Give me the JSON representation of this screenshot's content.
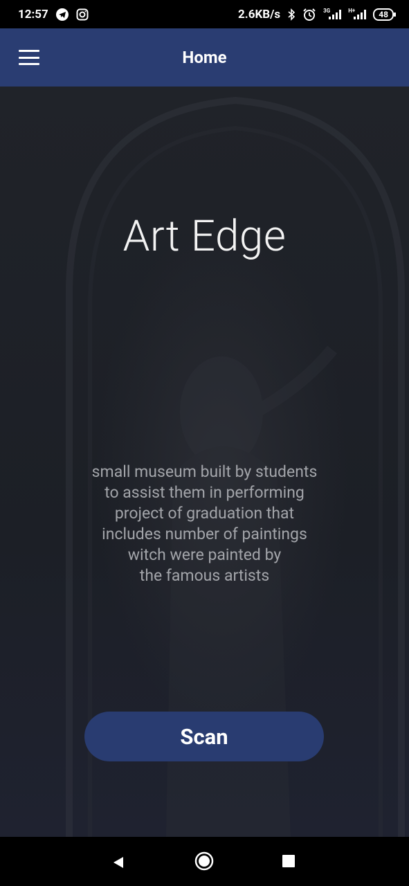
{
  "status_bar": {
    "time": "12:57",
    "network_speed": "2.6KB/s",
    "sim1_type": "3G",
    "sim2_type": "H+",
    "battery": "48",
    "icons": [
      "telegram-icon",
      "instagram-icon",
      "bluetooth-icon",
      "alarm-icon",
      "signal-icon",
      "signal-icon",
      "battery-icon"
    ]
  },
  "app_bar": {
    "title": "Home",
    "menu_icon": "hamburger-menu-icon",
    "color": "#2a3d72"
  },
  "main": {
    "title": "Art Edge",
    "description_lines": [
      "small museum built by students",
      "to assist them in performing",
      "project of graduation that",
      "includes number of paintings",
      "witch were painted by",
      "the famous artists"
    ],
    "scan_label": "Scan",
    "button_color": "#293c71"
  },
  "nav_bar": {
    "icons": [
      "back-icon",
      "home-icon",
      "recents-icon"
    ]
  }
}
